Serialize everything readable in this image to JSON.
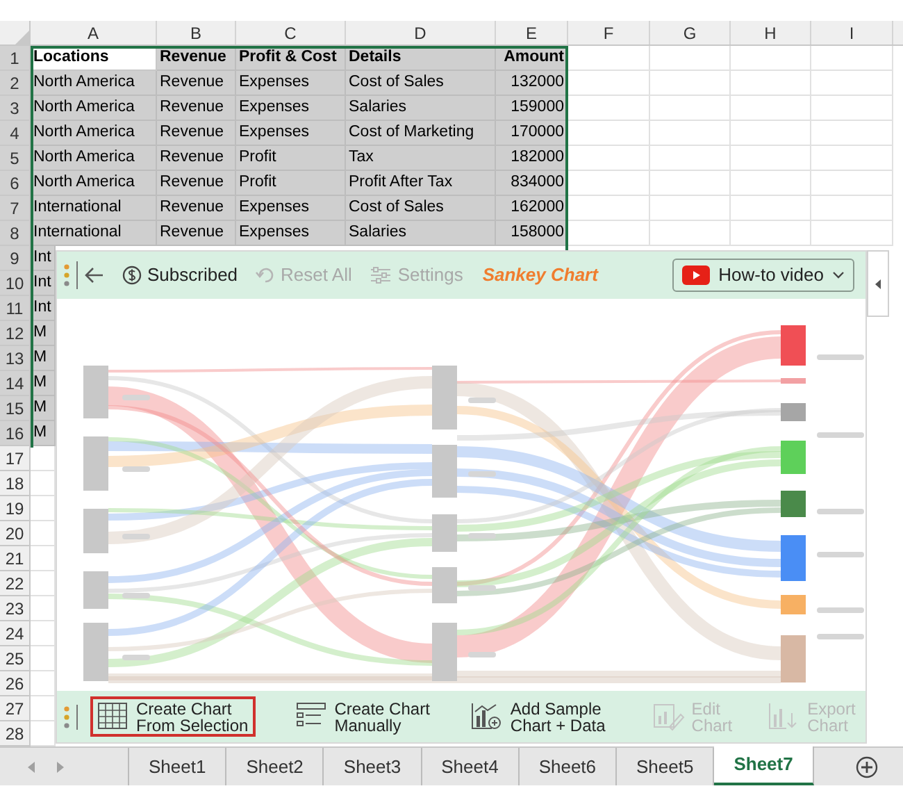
{
  "columns": [
    "A",
    "B",
    "C",
    "D",
    "E",
    "F",
    "G",
    "H",
    "I"
  ],
  "rows": [
    {
      "number": "1",
      "selected": true,
      "active": true,
      "kind": "header",
      "cells": [
        "Locations",
        "Revenue",
        "Profit & Cost",
        "Details",
        "Amount"
      ]
    },
    {
      "number": "2",
      "selected": true,
      "active": false,
      "kind": "data",
      "cells": [
        "North America",
        "Revenue",
        "Expenses",
        "Cost of Sales",
        "132000"
      ]
    },
    {
      "number": "3",
      "selected": true,
      "active": false,
      "kind": "data",
      "cells": [
        "North America",
        "Revenue",
        "Expenses",
        "Salaries",
        "159000"
      ]
    },
    {
      "number": "4",
      "selected": true,
      "active": false,
      "kind": "data",
      "cells": [
        "North America",
        "Revenue",
        "Expenses",
        "Cost of Marketing",
        "170000"
      ]
    },
    {
      "number": "5",
      "selected": true,
      "active": false,
      "kind": "data",
      "cells": [
        "North America",
        "Revenue",
        "Profit",
        "Tax",
        "182000"
      ]
    },
    {
      "number": "6",
      "selected": true,
      "active": false,
      "kind": "data",
      "cells": [
        "North America",
        "Revenue",
        "Profit",
        "Profit After Tax",
        "834000"
      ]
    },
    {
      "number": "7",
      "selected": true,
      "active": false,
      "kind": "data",
      "cells": [
        "International",
        "Revenue",
        "Expenses",
        "Cost of Sales",
        "162000"
      ]
    },
    {
      "number": "8",
      "selected": true,
      "active": false,
      "kind": "data",
      "cells": [
        "International",
        "Revenue",
        "Expenses",
        "Salaries",
        "158000"
      ]
    },
    {
      "number": "9",
      "selected": true,
      "active": false,
      "kind": "data",
      "cells": [
        "Int"
      ]
    },
    {
      "number": "10",
      "selected": true,
      "active": false,
      "kind": "data",
      "cells": [
        "Int"
      ]
    },
    {
      "number": "11",
      "selected": true,
      "active": false,
      "kind": "data",
      "cells": [
        "Int"
      ]
    },
    {
      "number": "12",
      "selected": true,
      "active": false,
      "kind": "data",
      "cells": [
        "M"
      ]
    },
    {
      "number": "13",
      "selected": true,
      "active": false,
      "kind": "data",
      "cells": [
        "M"
      ]
    },
    {
      "number": "14",
      "selected": true,
      "active": false,
      "kind": "data",
      "cells": [
        "M"
      ]
    },
    {
      "number": "15",
      "selected": true,
      "active": false,
      "kind": "data",
      "cells": [
        "M"
      ]
    },
    {
      "number": "16",
      "selected": true,
      "active": false,
      "kind": "data",
      "cells": [
        "M"
      ]
    },
    {
      "number": "17",
      "selected": false,
      "active": false,
      "kind": "data"
    },
    {
      "number": "18",
      "selected": false,
      "active": false,
      "kind": "data"
    },
    {
      "number": "19",
      "selected": false,
      "active": false,
      "kind": "data"
    },
    {
      "number": "20",
      "selected": false,
      "active": false,
      "kind": "data"
    },
    {
      "number": "21",
      "selected": false,
      "active": false,
      "kind": "data"
    },
    {
      "number": "22",
      "selected": false,
      "active": false,
      "kind": "data"
    },
    {
      "number": "23",
      "selected": false,
      "active": false,
      "kind": "data"
    },
    {
      "number": "24",
      "selected": false,
      "active": false,
      "kind": "data"
    },
    {
      "number": "25",
      "selected": false,
      "active": false,
      "kind": "data"
    },
    {
      "number": "26",
      "selected": false,
      "active": false,
      "kind": "data"
    },
    {
      "number": "27",
      "selected": false,
      "active": false,
      "kind": "data"
    },
    {
      "number": "28",
      "selected": false,
      "active": false,
      "kind": "data"
    }
  ],
  "panel": {
    "toolbar": [
      {
        "kind": "subscribed",
        "label": "Subscribed",
        "disabled": false
      },
      {
        "kind": "reset",
        "label": "Reset All",
        "disabled": true
      },
      {
        "kind": "settings",
        "label": "Settings",
        "disabled": true
      }
    ],
    "title": "Sankey Chart",
    "video_button": "How-to video",
    "actions": [
      {
        "kind": "selection",
        "lines": [
          "Create Chart",
          "From Selection"
        ],
        "selected": true,
        "disabled": false
      },
      {
        "kind": "manual",
        "lines": [
          "Create Chart",
          "Manually"
        ],
        "selected": false,
        "disabled": false
      },
      {
        "kind": "sample",
        "lines": [
          "Add Sample",
          "Chart + Data"
        ],
        "selected": false,
        "disabled": false
      },
      {
        "kind": "edit",
        "lines": [
          "Edit",
          "Chart"
        ],
        "selected": false,
        "disabled": true
      },
      {
        "kind": "export",
        "lines": [
          "Export",
          "Chart"
        ],
        "selected": false,
        "disabled": true
      }
    ]
  },
  "sheets": [
    {
      "label": "Sheet1",
      "selected": false
    },
    {
      "label": "Sheet2",
      "selected": false
    },
    {
      "label": "Sheet3",
      "selected": false
    },
    {
      "label": "Sheet4",
      "selected": false
    },
    {
      "label": "Sheet6",
      "selected": false
    },
    {
      "label": "Sheet5",
      "selected": false
    },
    {
      "label": "Sheet7",
      "selected": true
    }
  ]
}
